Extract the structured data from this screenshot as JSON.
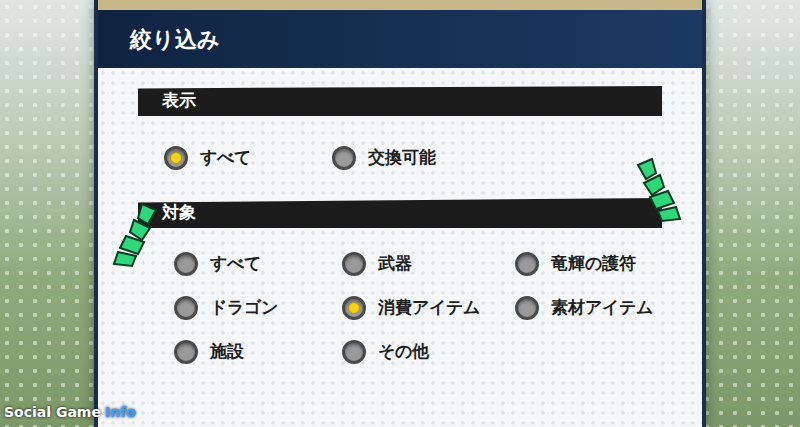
{
  "panel": {
    "title": "絞り込み"
  },
  "sections": [
    {
      "title": "表示",
      "columns": 2,
      "options": [
        {
          "label": "すべて",
          "selected": true
        },
        {
          "label": "交換可能",
          "selected": false
        }
      ]
    },
    {
      "title": "対象",
      "columns": 3,
      "options": [
        {
          "label": "すべて",
          "selected": false
        },
        {
          "label": "武器",
          "selected": false
        },
        {
          "label": "竜輝の護符",
          "selected": false
        },
        {
          "label": "ドラゴン",
          "selected": false
        },
        {
          "label": "消費アイテム",
          "selected": true
        },
        {
          "label": "素材アイテム",
          "selected": false
        },
        {
          "label": "施設",
          "selected": false
        },
        {
          "label": "その他",
          "selected": false
        }
      ]
    }
  ],
  "watermark": {
    "part_1": "Social Game",
    "part_2": "Info"
  }
}
